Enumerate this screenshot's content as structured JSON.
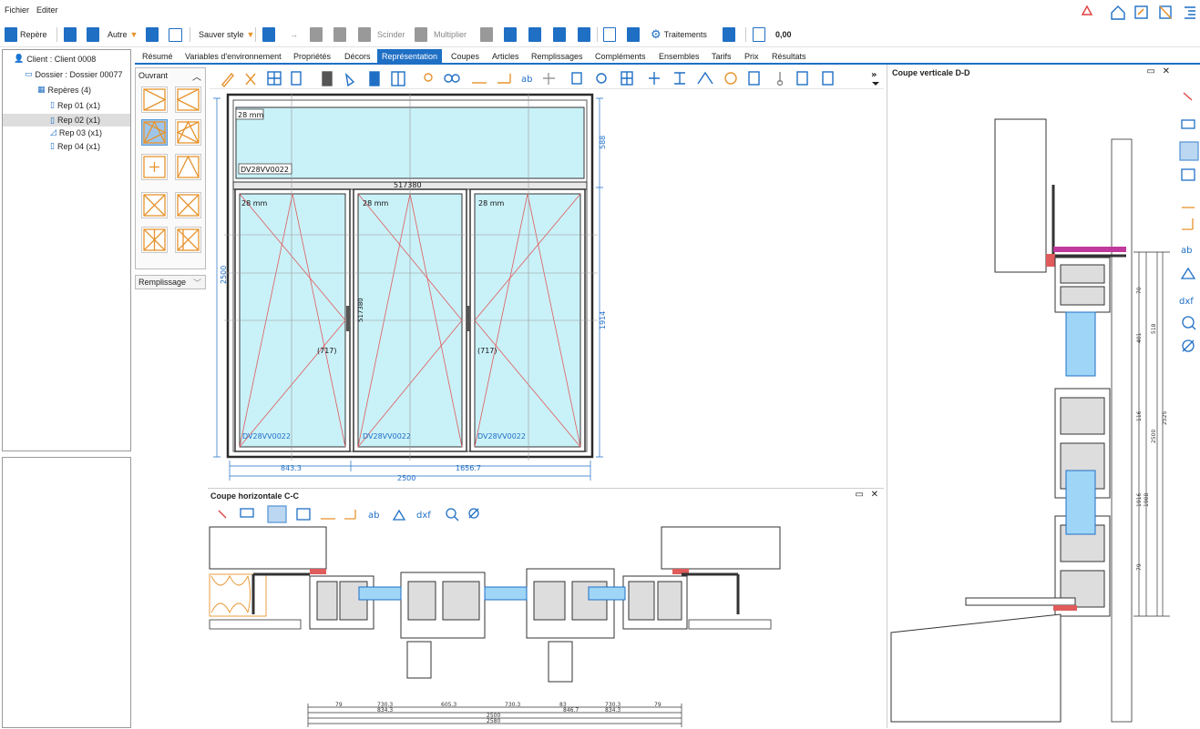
{
  "menu": {
    "file": "Fichier",
    "edit": "Editer"
  },
  "toolbar": {
    "repere": "Repère",
    "autre": "Autre",
    "sauver_style": "Sauver style",
    "scinder": "Scinder",
    "multiplier": "Multiplier",
    "traitements": "Traitements",
    "value": "0,00"
  },
  "tree": {
    "client": "Client : Client 0008",
    "dossier": "Dossier : Dossier 00077",
    "reperes": "Repères (4)",
    "items": [
      "Rep 01 (x1)",
      "Rep 02 (x1)",
      "Rep 03 (x1)",
      "Rep 04 (x1)"
    ]
  },
  "tabs": [
    "Résumé",
    "Variables d'environnement",
    "Propriétés",
    "Décors",
    "Représentation",
    "Coupes",
    "Articles",
    "Remplissages",
    "Compléments",
    "Ensembles",
    "Tarifs",
    "Prix",
    "Résultats"
  ],
  "active_tab": "Représentation",
  "ouvrant": {
    "title": "Ouvrant",
    "remplissage": "Remplissage"
  },
  "drawing": {
    "glass_thickness": "28 mm",
    "glass_ref": "DV28VV0022",
    "beam_ref": "517380",
    "mullion_ref": "517380",
    "sash_label": "(717)",
    "dim_total_width": "2500",
    "dim_left": "843.3",
    "dim_right": "1656.7",
    "dim_height": "2500",
    "dim_top": "588",
    "dim_lower": "1914"
  },
  "coupe_h": {
    "title": "Coupe horizontale C-C",
    "dims_row1": [
      "79",
      "730.3",
      "605.3",
      "730.3",
      "83",
      "730.3",
      "79"
    ],
    "dims_row2": [
      "834.3",
      "846.7",
      "834.3"
    ],
    "dims_row3": [
      "2500"
    ],
    "dims_row4": [
      "2580"
    ]
  },
  "coupe_v": {
    "title": "Coupe verticale D-D",
    "dims": [
      "70",
      "401",
      "518",
      "116",
      "2500",
      "2525",
      "1916",
      "1908",
      "79"
    ]
  },
  "colors": {
    "accent": "#1f6fc5",
    "glass": "#c9f1f8",
    "frame": "#2b2b2b",
    "sash_line": "#e05b5b",
    "orange": "#e6932d"
  }
}
